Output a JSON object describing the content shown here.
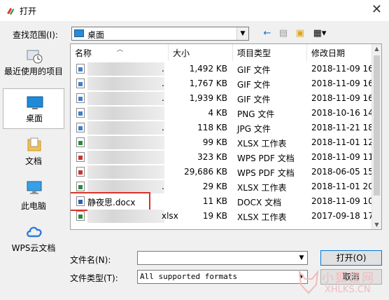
{
  "window": {
    "title": "打开",
    "close_glyph": "✕"
  },
  "lookin": {
    "label": "查找范围(I):",
    "value": "桌面"
  },
  "toolbar": {
    "back": "←",
    "up": "📁",
    "newfolder": "📂",
    "view": "▦▾"
  },
  "places": [
    {
      "name": "recent",
      "label": "最近使用的项目"
    },
    {
      "name": "desktop",
      "label": "桌面"
    },
    {
      "name": "documents",
      "label": "文档"
    },
    {
      "name": "computer",
      "label": "此电脑"
    },
    {
      "name": "wps-cloud",
      "label": "WPS云文档"
    }
  ],
  "columns": {
    "name": "名称",
    "size": "大小",
    "type": "项目类型",
    "date": "修改日期"
  },
  "files": [
    {
      "icon": "img",
      "name": ".",
      "size": "1,492 KB",
      "type": "GIF 文件",
      "date": "2018-11-09 16."
    },
    {
      "icon": "img",
      "name": ".",
      "size": "1,767 KB",
      "type": "GIF 文件",
      "date": "2018-11-09 16."
    },
    {
      "icon": "img",
      "name": ".",
      "size": "1,939 KB",
      "type": "GIF 文件",
      "date": "2018-11-09 16."
    },
    {
      "icon": "img",
      "name": "",
      "size": "4 KB",
      "type": "PNG 文件",
      "date": "2018-10-16 14."
    },
    {
      "icon": "img",
      "name": ".",
      "size": "118 KB",
      "type": "JPG 文件",
      "date": "2018-11-21 18."
    },
    {
      "icon": "xls",
      "name": "",
      "size": "99 KB",
      "type": "XLSX 工作表",
      "date": "2018-11-01 12."
    },
    {
      "icon": "pdf",
      "name": "",
      "size": "323 KB",
      "type": "WPS PDF 文档",
      "date": "2018-11-09 11."
    },
    {
      "icon": "pdf",
      "name": "",
      "size": "29,686 KB",
      "type": "WPS PDF 文档",
      "date": "2018-06-05 15."
    },
    {
      "icon": "xls",
      "name": ".",
      "size": "29 KB",
      "type": "XLSX 工作表",
      "date": "2018-11-01 20."
    },
    {
      "icon": "doc",
      "name": "静夜思.docx",
      "size": "11 KB",
      "type": "DOCX 文档",
      "date": "2018-11-09 10."
    },
    {
      "icon": "xls",
      "name": "xlsx",
      "size": "19 KB",
      "type": "XLSX 工作表",
      "date": "2017-09-18 17."
    }
  ],
  "filename": {
    "label": "文件名(N):",
    "value": ""
  },
  "filetype": {
    "label": "文件类型(T):",
    "value": "All supported formats"
  },
  "buttons": {
    "open": "打开(O)",
    "cancel": "取消"
  },
  "watermark": {
    "cn": "小狐狸网",
    "en": "XHLKS.CN"
  },
  "colors": {
    "accent": "#0078d7",
    "highlight": "#d9332b"
  }
}
